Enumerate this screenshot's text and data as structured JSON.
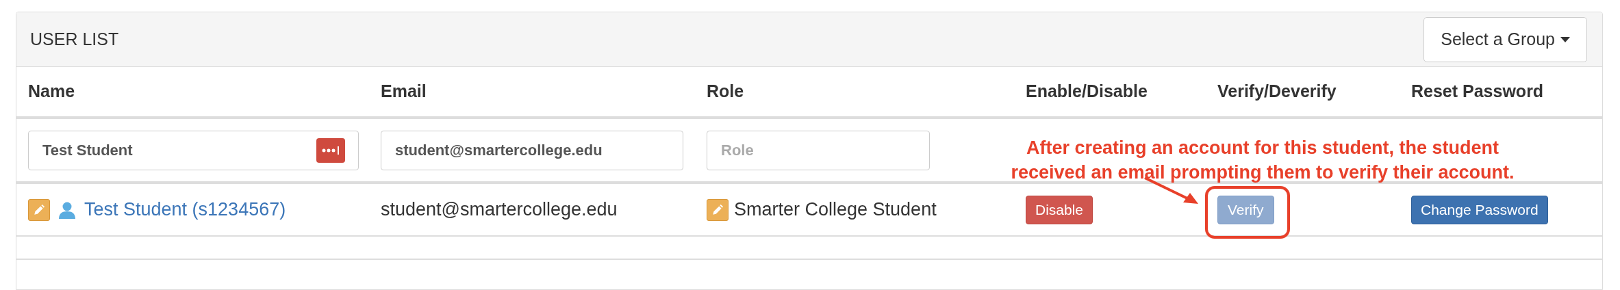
{
  "panel": {
    "title": "USER LIST",
    "group_select": {
      "label": "Select a Group"
    }
  },
  "table": {
    "columns": [
      "Name",
      "Email",
      "Role",
      "Enable/Disable",
      "Verify/Deverify",
      "Reset Password"
    ],
    "filters": [
      {
        "value": "Test Student"
      },
      {
        "value": "student@smartercollege.edu"
      },
      {
        "placeholder": "Role"
      }
    ],
    "rows": [
      {
        "name": "Test Student (s1234567)",
        "email": "student@smartercollege.edu",
        "role": "Smarter College Student",
        "enable_button": {
          "label": "Disable"
        },
        "verify_button": {
          "label": "Verify",
          "disabled": true
        },
        "reset_button": {
          "label": "Change Password"
        }
      }
    ]
  },
  "annotation": {
    "lines": [
      "After creating an account for this student, the student",
      "received an email prompting them to verify their account."
    ]
  }
}
